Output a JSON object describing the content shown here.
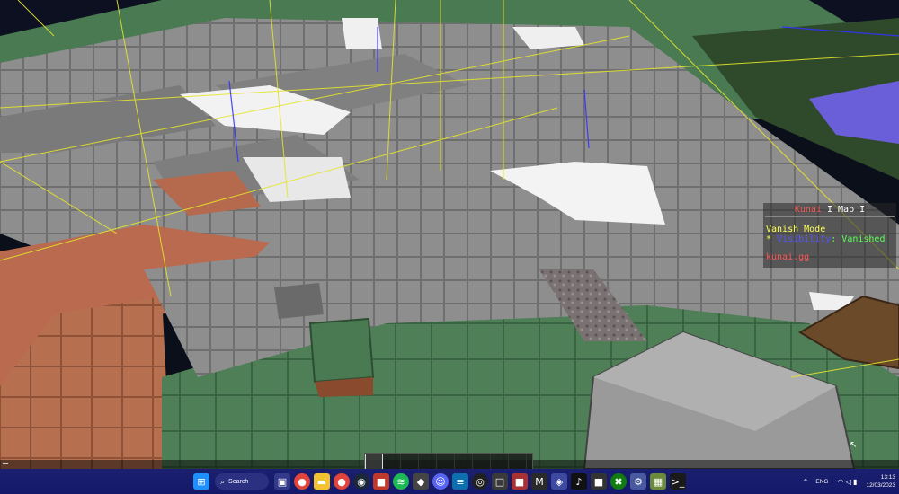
{
  "scoreboard": {
    "title_part1": "Kunai",
    "title_part2": " I Map I",
    "vanish_mode": "Vanish Mode",
    "visibility_bullet": "* ",
    "visibility_key": "Visibility",
    "visibility_value": ": Vanished",
    "site": "kunai.gg"
  },
  "hotbar": {
    "slots": 9,
    "selected": 0
  },
  "taskbar": {
    "search_label": "Search",
    "lang": "ENG",
    "time": "13:13",
    "date": "12/03/2023",
    "icons": [
      "start-icon",
      "search-icon",
      "task-view-icon",
      "chrome-icon",
      "file-explorer-icon",
      "chrome-icon",
      "steam-icon",
      "app-icon",
      "spotify-icon",
      "app-icon",
      "discord-icon",
      "vscode-icon",
      "obs-icon",
      "app-icon",
      "app-icon",
      "app-icon",
      "app-icon",
      "tiktok-icon",
      "app-icon",
      "xbox-icon",
      "settings-icon",
      "minecraft-icon",
      "terminal-icon"
    ]
  },
  "colors": {
    "stone": "#8c8c8c",
    "grass": "#4a7a52",
    "terracotta": "#b96a4f",
    "snow": "#f2f2f2",
    "chunk_border": "#e5e52a",
    "taskbar": "#1a1f6e"
  }
}
